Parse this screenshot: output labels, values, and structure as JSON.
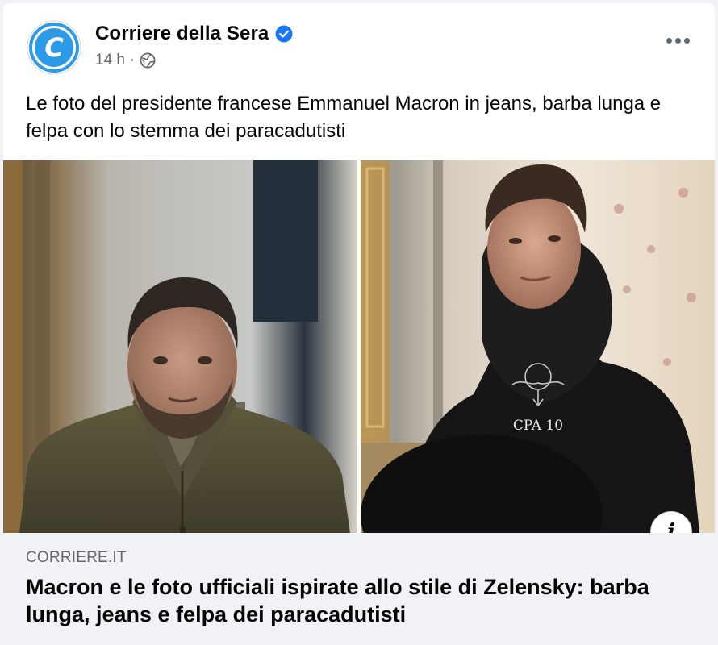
{
  "post": {
    "page_name": "Corriere della Sera",
    "avatar_icon": "corriere-logo",
    "verified_icon": "verified-badge-icon",
    "timestamp": "14 h",
    "separator": "·",
    "audience_icon": "globe-icon",
    "more_icon": "more-options-icon",
    "text": "Le foto del presidente francese Emmanuel Macron in jeans, barba lunga e felpa con lo stemma dei paracadutisti"
  },
  "media": {
    "hoodie_caption": "CPA 10",
    "info_label": "i"
  },
  "link_preview": {
    "domain": "CORRIERE.IT",
    "title": "Macron e le foto ufficiali ispirate allo stile di Zelensky: barba lunga, jeans e felpa dei paracadutisti"
  },
  "colors": {
    "brand_blue": "#2d9ae8",
    "verified_blue": "#1877f2",
    "secondary_text": "#65676b",
    "link_bg": "#f0f2f5"
  }
}
